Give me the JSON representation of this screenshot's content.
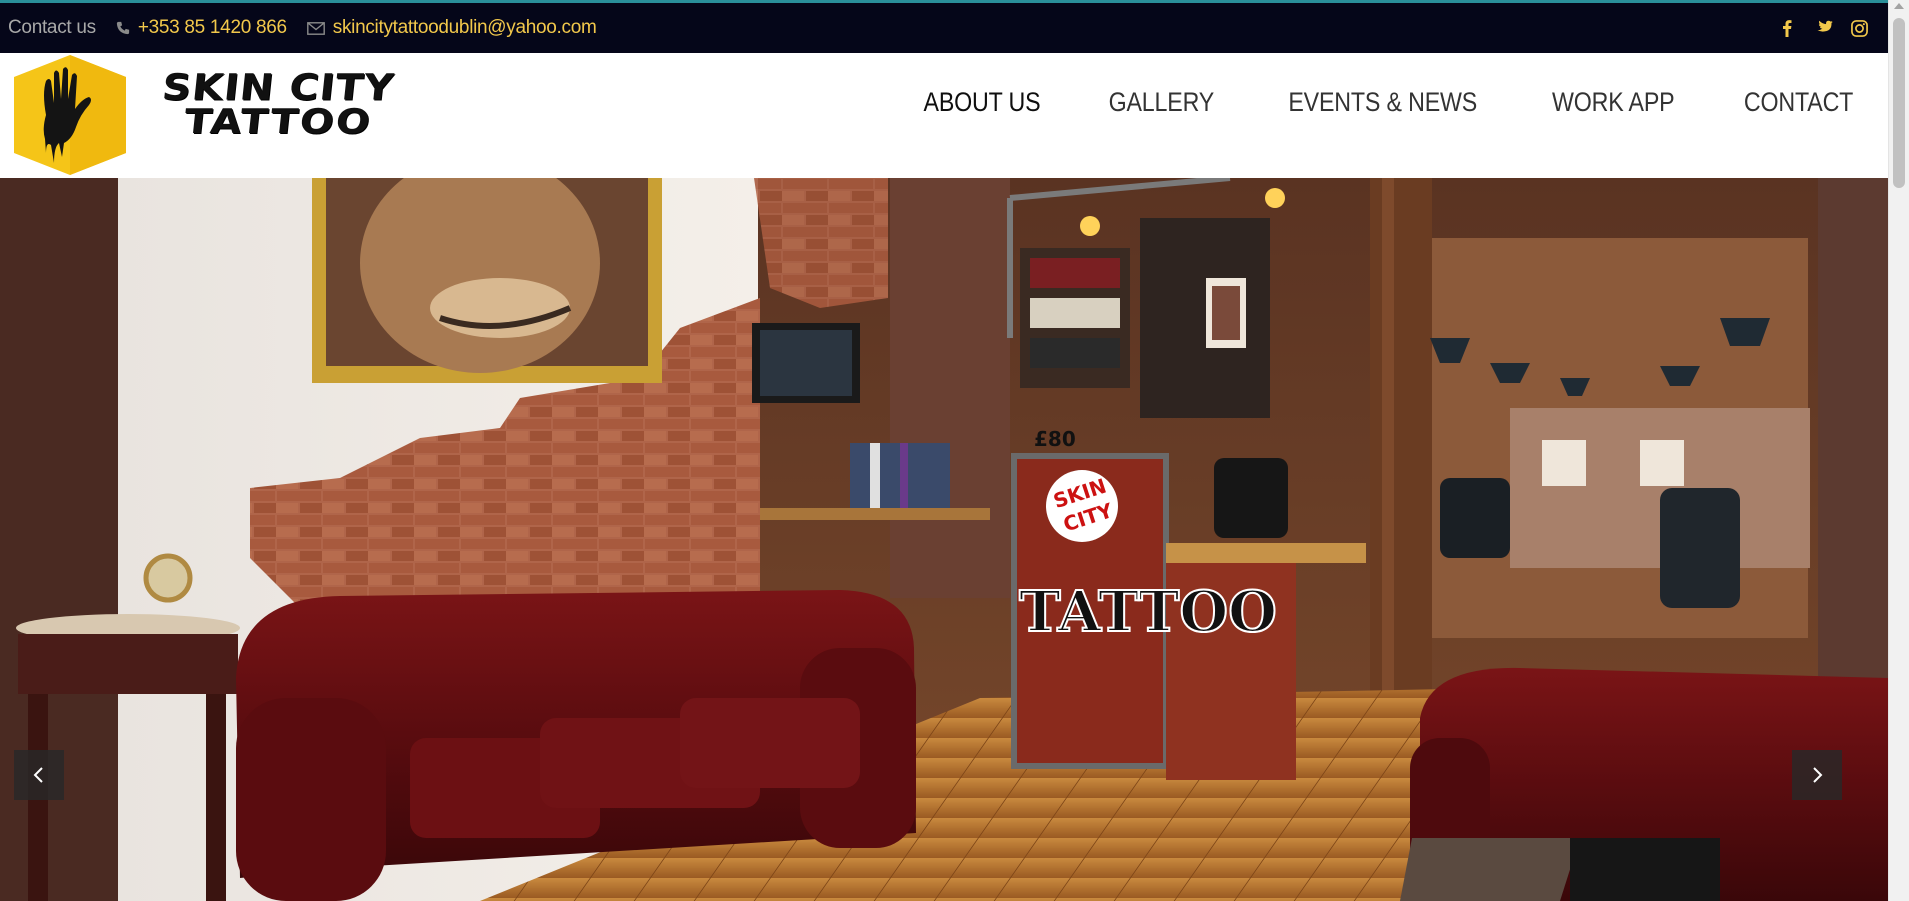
{
  "topbar": {
    "contact_label": "Contact us",
    "phone": "+353 85 1420 866",
    "email": "skincitytattoodublin@yahoo.com",
    "socials": [
      "facebook-icon",
      "twitter-icon",
      "instagram-icon"
    ],
    "background": "#050619",
    "accent": "#f2c84b"
  },
  "logo": {
    "line1": "SKIN CITY",
    "line2": "TATTOO",
    "badge_color": "#f5c518"
  },
  "nav": {
    "items": [
      {
        "label": "ABOUT US",
        "active": true
      },
      {
        "label": "GALLERY",
        "active": false
      },
      {
        "label": "EVENTS & NEWS",
        "active": false
      },
      {
        "label": "WORK APP",
        "active": false
      },
      {
        "label": "CONTACT",
        "active": false
      }
    ]
  },
  "hero": {
    "sign_text": "TATTOO",
    "sign_logo_line1": "SKIN",
    "sign_logo_line2": "CITY",
    "price_tag": "£80"
  },
  "slider": {
    "prev_icon": "chevron-left-icon",
    "next_icon": "chevron-right-icon"
  }
}
